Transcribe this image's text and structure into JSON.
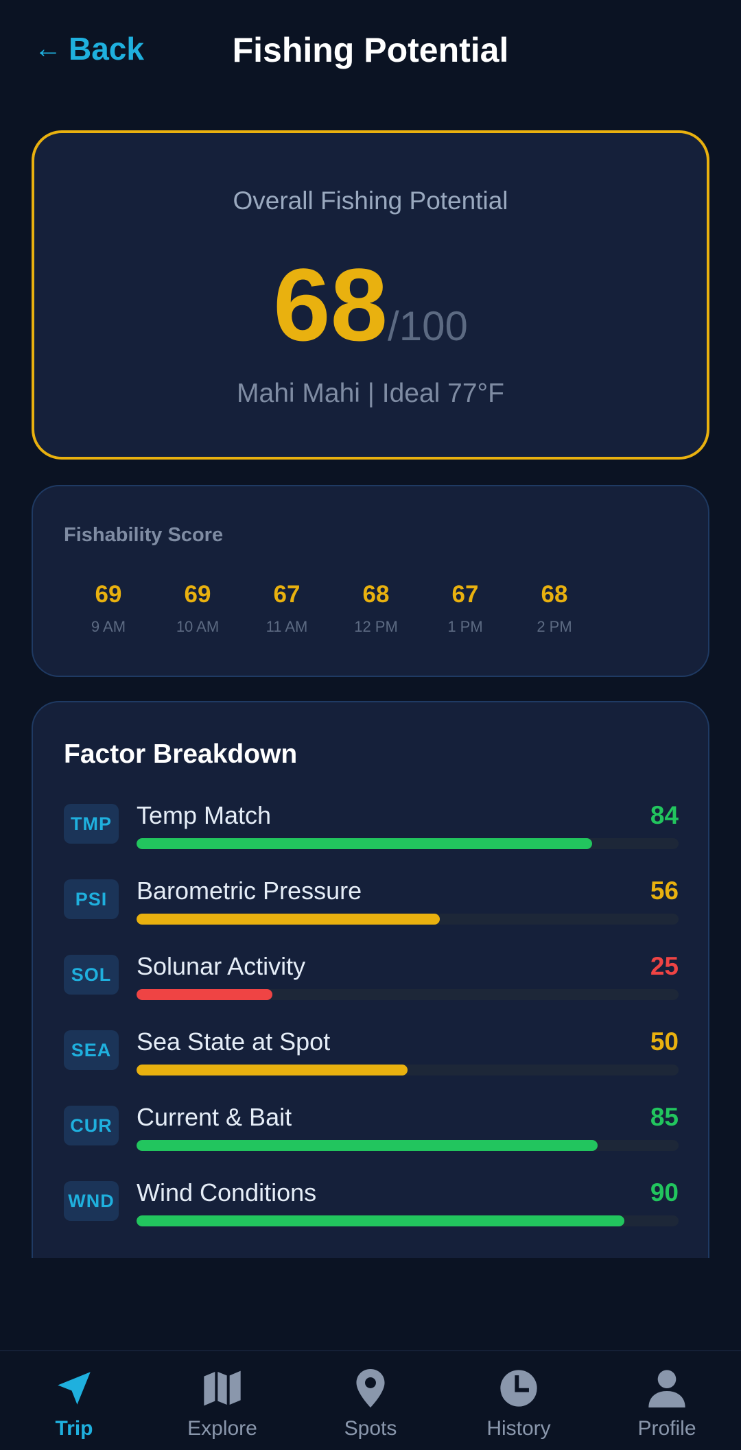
{
  "header": {
    "back_label": "Back",
    "back_arrow": "←",
    "title": "Fishing Potential"
  },
  "overall": {
    "label": "Overall Fishing Potential",
    "score": "68",
    "out_of": "/100",
    "subtitle": "Mahi Mahi | Ideal 77°F",
    "accent": "#e9b10f"
  },
  "fishability": {
    "label": "Fishability Score",
    "hours": [
      {
        "value": "69",
        "time": "9 AM"
      },
      {
        "value": "69",
        "time": "10 AM"
      },
      {
        "value": "67",
        "time": "11 AM"
      },
      {
        "value": "68",
        "time": "12 PM"
      },
      {
        "value": "67",
        "time": "1 PM"
      },
      {
        "value": "68",
        "time": "2 PM"
      }
    ]
  },
  "factors": {
    "heading": "Factor Breakdown",
    "items": [
      {
        "code": "TMP",
        "name": "Temp Match",
        "value": 84,
        "progress": 0.84,
        "color": "#22c55e"
      },
      {
        "code": "PSI",
        "name": "Barometric Pressure",
        "value": 56,
        "progress": 0.56,
        "color": "#e9b10f"
      },
      {
        "code": "SOL",
        "name": "Solunar Activity",
        "value": 25,
        "progress": 0.25,
        "color": "#ef4444"
      },
      {
        "code": "SEA",
        "name": "Sea State at Spot",
        "value": 50,
        "progress": 0.5,
        "color": "#e9b10f"
      },
      {
        "code": "CUR",
        "name": "Current & Bait",
        "value": 85,
        "progress": 0.85,
        "color": "#22c55e"
      },
      {
        "code": "WND",
        "name": "Wind Conditions",
        "value": 90,
        "progress": 0.9,
        "color": "#22c55e"
      }
    ]
  },
  "nav": {
    "items": [
      {
        "label": "Trip",
        "icon": "navigation-arrow-icon",
        "active": true
      },
      {
        "label": "Explore",
        "icon": "map-icon",
        "active": false
      },
      {
        "label": "Spots",
        "icon": "map-pin-icon",
        "active": false
      },
      {
        "label": "History",
        "icon": "clock-icon",
        "active": false
      },
      {
        "label": "Profile",
        "icon": "person-icon",
        "active": false
      }
    ],
    "active_color": "#1fb0de",
    "inactive_color": "#8a97ac"
  }
}
